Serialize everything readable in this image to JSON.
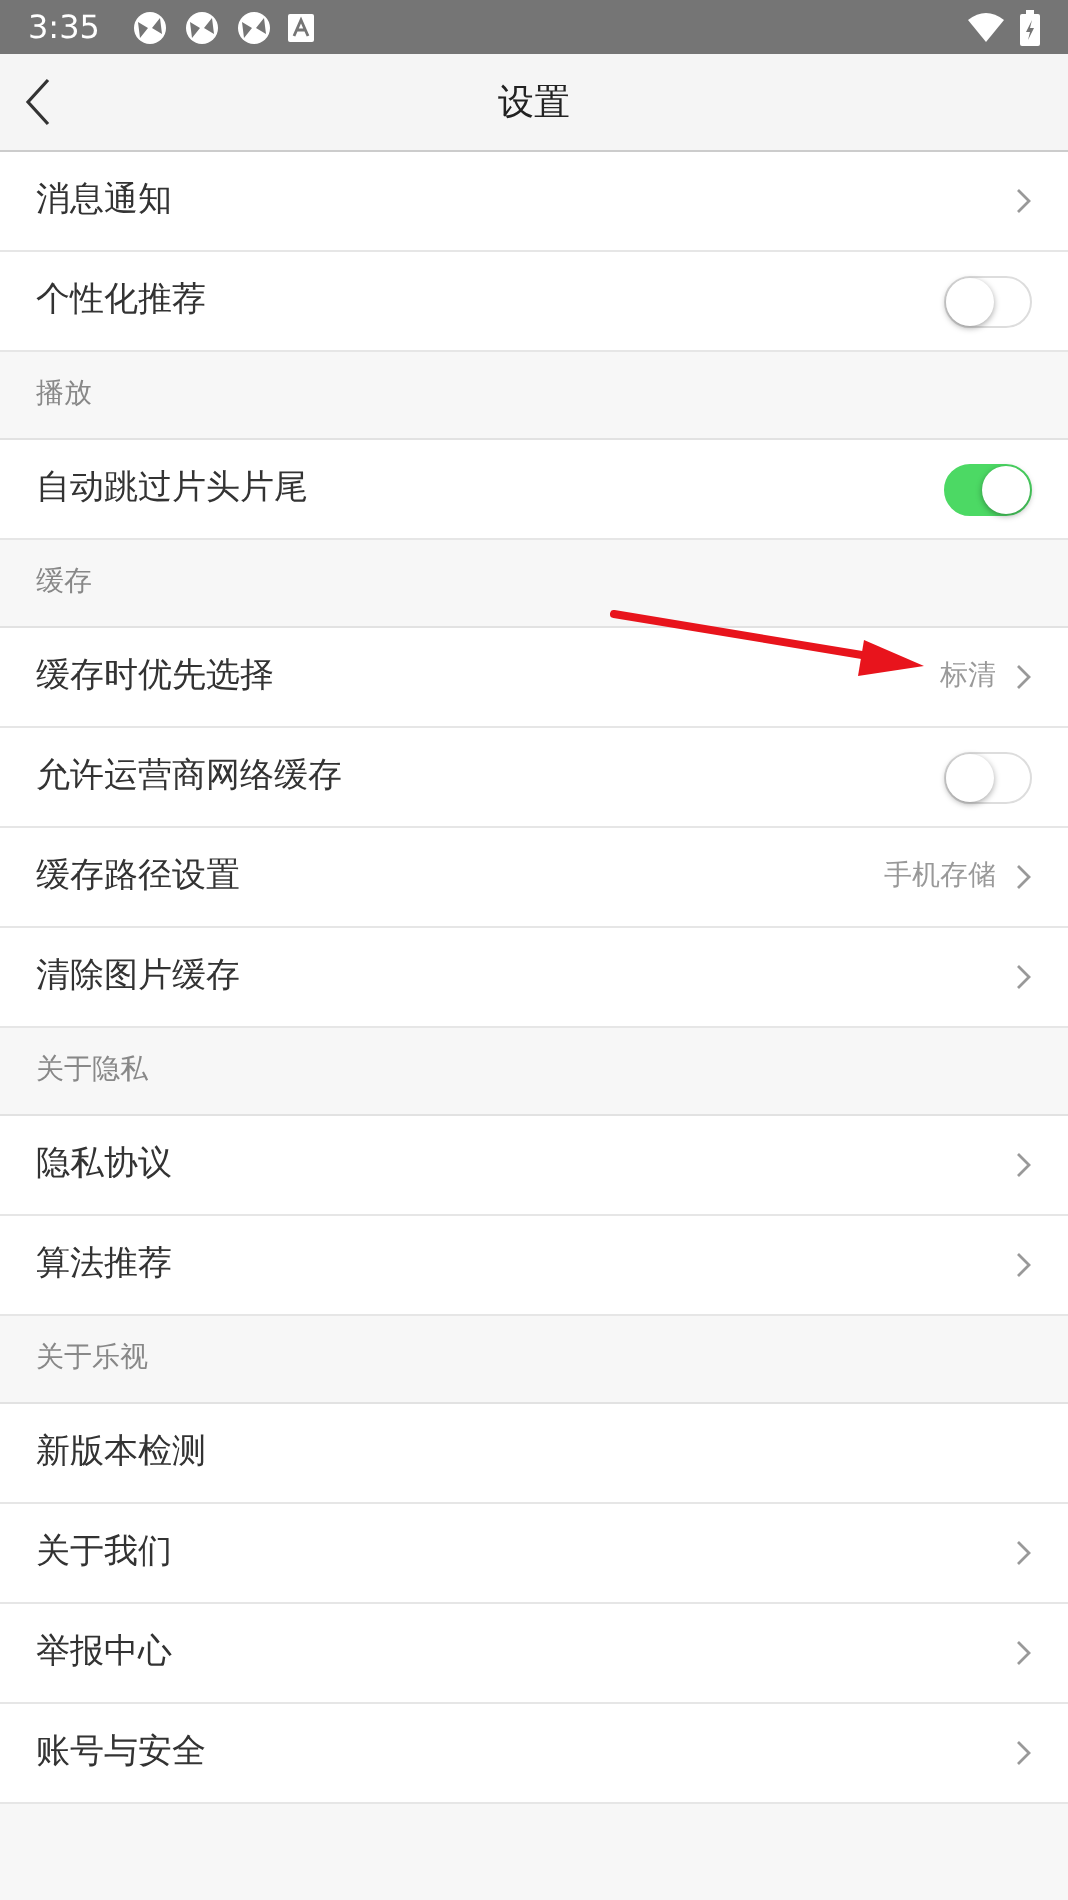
{
  "status_bar": {
    "time": "3:35",
    "notification_icons": [
      {
        "kind": "app"
      },
      {
        "kind": "app"
      },
      {
        "kind": "app"
      },
      {
        "kind": "keyboard"
      }
    ]
  },
  "header": {
    "title": "设置"
  },
  "sections": [
    {
      "items": [
        {
          "kind": "link",
          "label": "消息通知"
        },
        {
          "kind": "toggle",
          "label": "个性化推荐",
          "on": false
        }
      ]
    },
    {
      "title": "播放",
      "items": [
        {
          "kind": "toggle",
          "label": "自动跳过片头片尾",
          "on": true
        }
      ]
    },
    {
      "title": "缓存",
      "items": [
        {
          "kind": "link",
          "label": "缓存时优先选择",
          "value": "标清"
        },
        {
          "kind": "toggle",
          "label": "允许运营商网络缓存",
          "on": false
        },
        {
          "kind": "link",
          "label": "缓存路径设置",
          "value": "手机存储"
        },
        {
          "kind": "link",
          "label": "清除图片缓存"
        }
      ]
    },
    {
      "title": "关于隐私",
      "items": [
        {
          "kind": "link",
          "label": "隐私协议"
        },
        {
          "kind": "link",
          "label": "算法推荐"
        }
      ]
    },
    {
      "title": "关于乐视",
      "items": [
        {
          "kind": "plain",
          "label": "新版本检测"
        },
        {
          "kind": "link",
          "label": "关于我们"
        },
        {
          "kind": "link",
          "label": "举报中心"
        },
        {
          "kind": "link",
          "label": "账号与安全"
        }
      ]
    }
  ],
  "annotations": [
    {
      "kind": "arrow"
    }
  ]
}
